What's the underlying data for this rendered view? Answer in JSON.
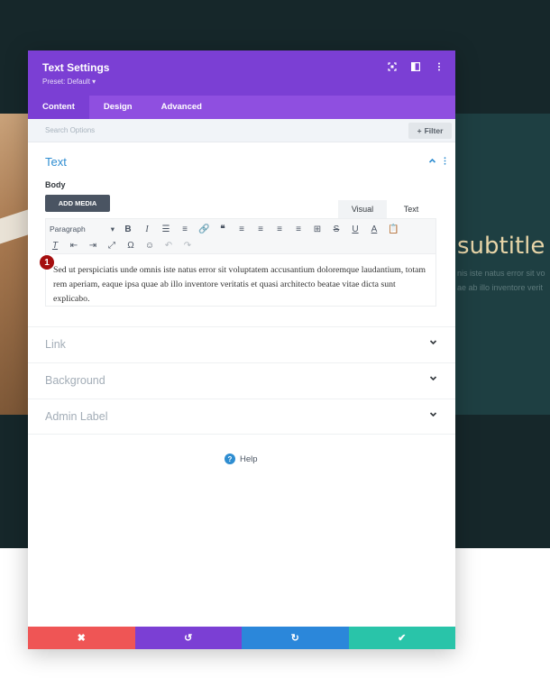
{
  "background": {
    "subtitle": "subtitle",
    "line1": "nis iste natus error sit vo",
    "line2": "ae ab illo inventore verit"
  },
  "modal": {
    "title": "Text Settings",
    "preset": "Preset: Default ▾",
    "header_icons": [
      "focus-icon",
      "sidebar-toggle-icon",
      "more-icon"
    ],
    "tabs": [
      {
        "label": "Content",
        "active": true
      },
      {
        "label": "Design",
        "active": false
      },
      {
        "label": "Advanced",
        "active": false
      }
    ],
    "search": {
      "placeholder": "Search Options",
      "filter_label": "Filter"
    },
    "text_section": {
      "title": "Text",
      "body_label": "Body",
      "add_media": "ADD MEDIA",
      "editor_tabs": [
        {
          "label": "Visual",
          "active": false
        },
        {
          "label": "Text",
          "active": true
        }
      ],
      "format_select": "Paragraph",
      "badge": "1",
      "content": "Sed ut perspiciatis unde omnis iste natus error sit voluptatem accusantium doloremque laudantium, totam rem aperiam, eaque ipsa quae ab illo inventore veritatis et quasi architecto beatae vitae dicta sunt explicabo."
    },
    "toggles": [
      {
        "label": "Link"
      },
      {
        "label": "Background"
      },
      {
        "label": "Admin Label"
      }
    ],
    "help": "Help"
  },
  "colors": {
    "header": "#7b3fd4",
    "tabs": "#8f4fe0",
    "accent_blue": "#2e8dd1",
    "cancel": "#ef5555",
    "undo": "#7b3fd4",
    "redo": "#2b87da",
    "save": "#29c4a9"
  },
  "footer_buttons": [
    {
      "icon": "close-icon",
      "glyph": "✖"
    },
    {
      "icon": "undo-icon",
      "glyph": "↺"
    },
    {
      "icon": "redo-icon",
      "glyph": "↻"
    },
    {
      "icon": "check-icon",
      "glyph": "✔"
    }
  ]
}
